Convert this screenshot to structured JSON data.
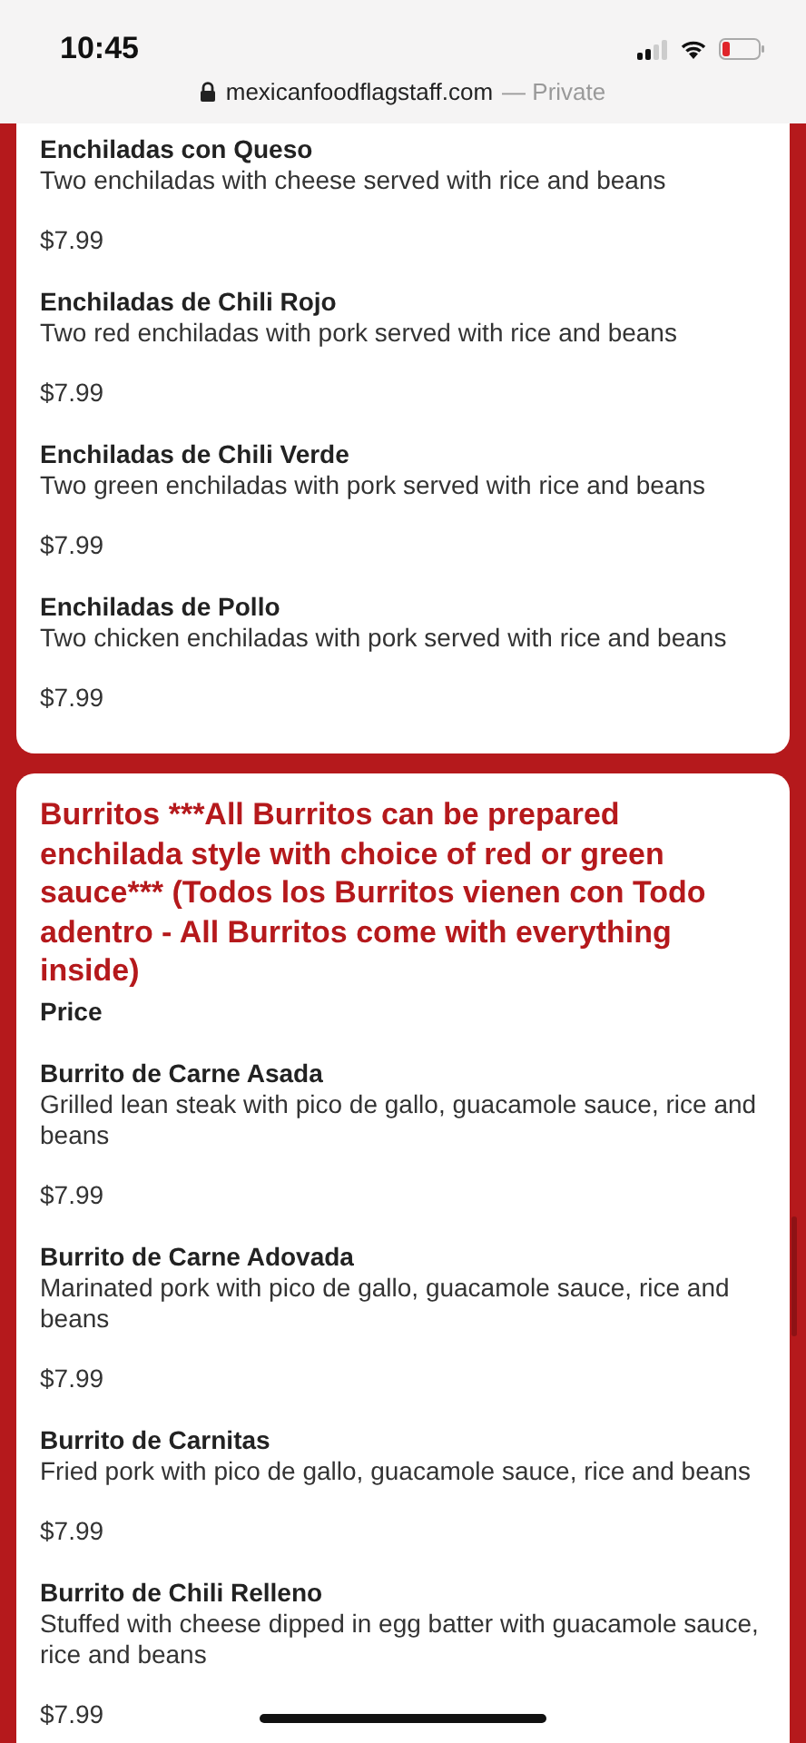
{
  "status_bar": {
    "time": "10:45"
  },
  "address_bar": {
    "url": "mexicanfoodflagstaff.com",
    "suffix": "— Private"
  },
  "sections": [
    {
      "items": [
        {
          "name": "Enchiladas con Queso",
          "description": "Two enchiladas with cheese served with rice and beans",
          "price": "$7.99"
        },
        {
          "name": "Enchiladas de Chili Rojo",
          "description": "Two red enchiladas with pork served with rice and beans",
          "price": "$7.99"
        },
        {
          "name": "Enchiladas de Chili Verde",
          "description": "Two green enchiladas with pork served with rice and beans",
          "price": "$7.99"
        },
        {
          "name": "Enchiladas de Pollo",
          "description": "Two chicken enchiladas with pork served with rice and beans",
          "price": "$7.99"
        }
      ]
    },
    {
      "title": "Burritos ***All Burritos can be prepared enchilada style with choice of red or green sauce*** (Todos los Burritos vienen con Todo adentro - All Burritos come with everything inside)",
      "price_label": "Price",
      "items": [
        {
          "name": "Burrito de Carne Asada",
          "description": "Grilled lean steak with pico de gallo, guacamole sauce, rice and beans",
          "price": "$7.99"
        },
        {
          "name": "Burrito de Carne Adovada",
          "description": "Marinated pork with pico de gallo, guacamole sauce, rice and beans",
          "price": "$7.99"
        },
        {
          "name": "Burrito de Carnitas",
          "description": "Fried pork with pico de gallo, guacamole sauce, rice and beans",
          "price": "$7.99"
        },
        {
          "name": "Burrito de Chili Relleno",
          "description": "Stuffed with cheese dipped in egg batter with guacamole sauce, rice and beans",
          "price": "$7.99"
        }
      ]
    }
  ]
}
